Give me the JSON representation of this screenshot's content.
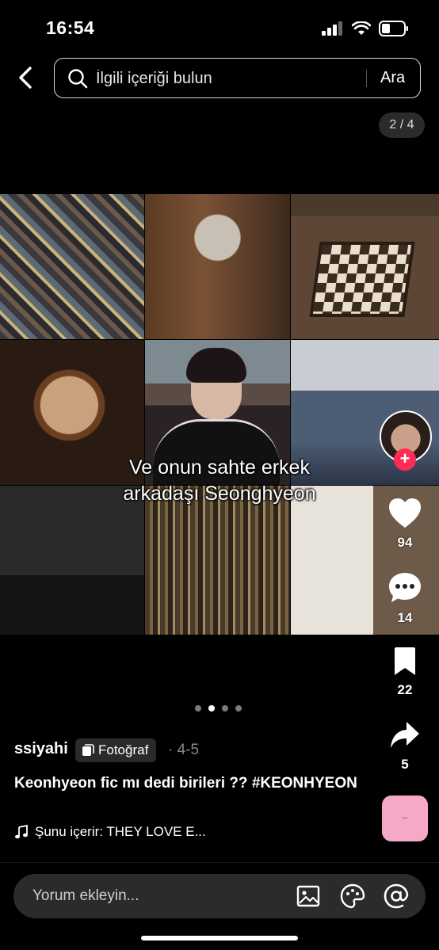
{
  "status_bar": {
    "time": "16:54"
  },
  "search": {
    "placeholder": "İlgili içeriği bulun",
    "button_label": "Ara"
  },
  "counter": "2 / 4",
  "overlay": {
    "line1": "Ve onun sahte erkek",
    "line2": "arkadaşı Seonghyeon"
  },
  "rail": {
    "likes": "94",
    "comments": "14",
    "bookmarks": "22",
    "shares": "5"
  },
  "post": {
    "author": "ssiyahi",
    "type_badge": "Fotoğraf",
    "date": "· 4-5",
    "title": "Keonhyeon fic mı dedi birileri ?? #KEONHYEON",
    "music": "Şunu içerir: THEY LOVE E..."
  },
  "pagination": {
    "total": 4,
    "current": 2
  },
  "comment": {
    "placeholder": "Yorum ekleyin..."
  },
  "colors": {
    "accent": "#ff2b56",
    "background": "#000000"
  }
}
